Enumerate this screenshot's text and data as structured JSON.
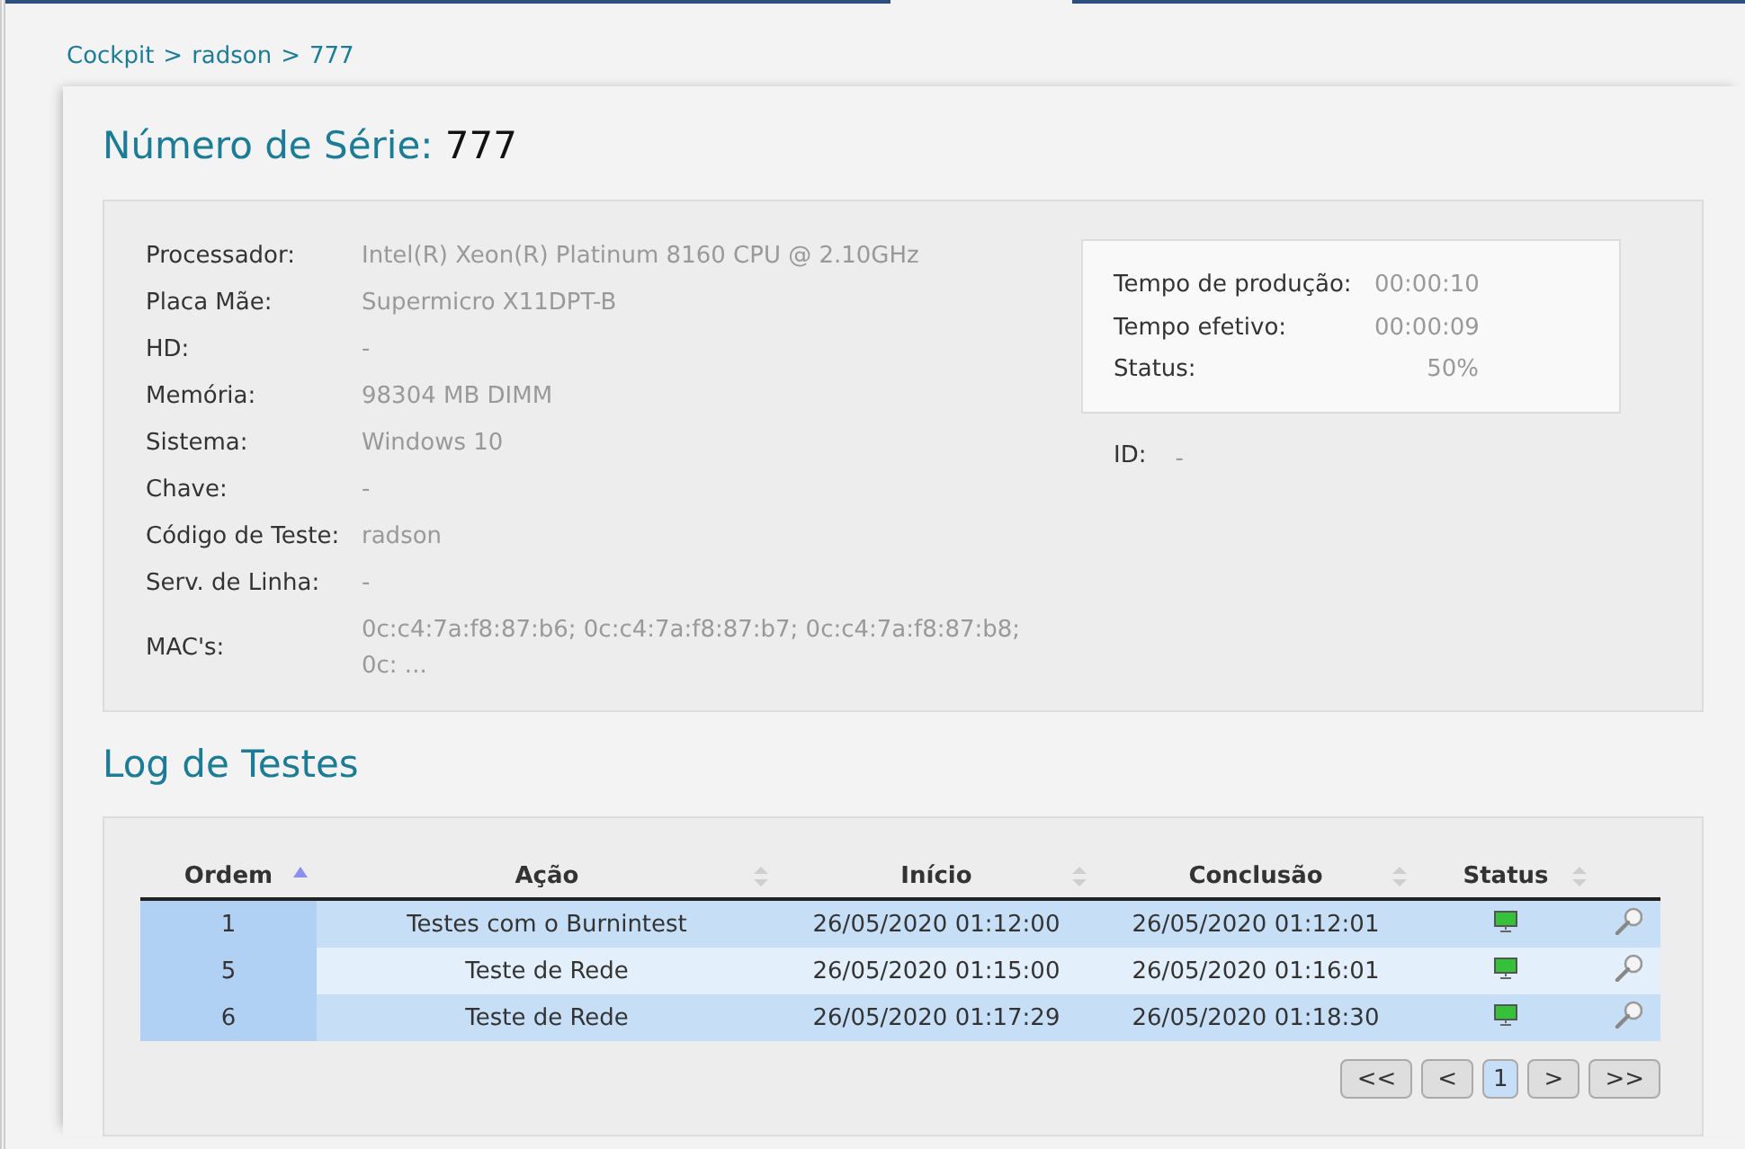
{
  "breadcrumb": {
    "separator": ">",
    "items": [
      "Cockpit",
      "radson",
      "777"
    ]
  },
  "title": {
    "label": "Número de Série:",
    "value": "777"
  },
  "hardware": [
    {
      "label": "Processador:",
      "value": "Intel(R) Xeon(R) Platinum 8160 CPU @ 2.10GHz"
    },
    {
      "label": "Placa Mãe:",
      "value": "Supermicro X11DPT-B"
    },
    {
      "label": "HD:",
      "value": "-"
    },
    {
      "label": "Memória:",
      "value": "98304 MB DIMM"
    },
    {
      "label": "Sistema:",
      "value": "Windows 10"
    },
    {
      "label": "Chave:",
      "value": "-"
    },
    {
      "label": "Código de Teste:",
      "value": "radson"
    },
    {
      "label": "Serv. de Linha:",
      "value": "-"
    },
    {
      "label": "MAC's:",
      "value": "0c:c4:7a:f8:87:b6; 0c:c4:7a:f8:87:b7; 0c:c4:7a:f8:87:b8; 0c: ..."
    }
  ],
  "times": [
    {
      "label": "Tempo de produção:",
      "value": "00:00:10"
    },
    {
      "label": "Tempo efetivo:",
      "value": "00:00:09"
    },
    {
      "label": "Status:",
      "value": "50%"
    }
  ],
  "id": {
    "label": "ID:",
    "value": "-"
  },
  "log": {
    "title": "Log de Testes",
    "columns": [
      {
        "label": "Ordem",
        "sorted": true
      },
      {
        "label": "Ação",
        "sorted": false
      },
      {
        "label": "Início",
        "sorted": false
      },
      {
        "label": "Conclusão",
        "sorted": false
      },
      {
        "label": "Status",
        "sorted": false
      }
    ],
    "rows": [
      {
        "cells": [
          "1",
          "Testes com o Burnintest",
          "26/05/2020 01:12:00",
          "26/05/2020 01:12:01"
        ]
      },
      {
        "cells": [
          "5",
          "Teste de Rede",
          "26/05/2020 01:15:00",
          "26/05/2020 01:16:01"
        ]
      },
      {
        "cells": [
          "6",
          "Teste de Rede",
          "26/05/2020 01:17:29",
          "26/05/2020 01:18:30"
        ]
      }
    ],
    "pager": [
      {
        "label": "<<",
        "selected": false
      },
      {
        "label": "<",
        "selected": false
      },
      {
        "label": "1",
        "selected": true
      },
      {
        "label": ">",
        "selected": false
      },
      {
        "label": ">>",
        "selected": false
      }
    ]
  }
}
